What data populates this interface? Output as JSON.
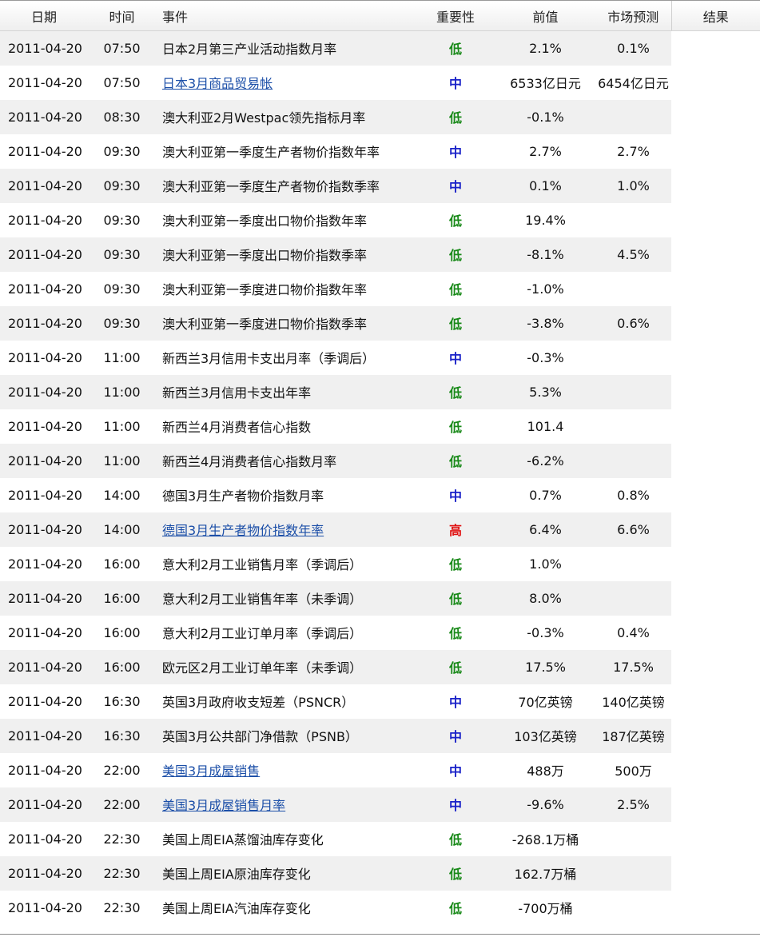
{
  "headers": {
    "date": "日期",
    "time": "时间",
    "event": "事件",
    "importance": "重要性",
    "previous": "前值",
    "forecast": "市场预测",
    "result": "结果"
  },
  "importance_colors": {
    "低": "#1a8a1a",
    "中": "#1a22c8",
    "高": "#e01010"
  },
  "rows": [
    {
      "date": "2011-04-20",
      "time": "07:50",
      "event": "日本2月第三产业活动指数月率",
      "link": false,
      "importance": "低",
      "previous": "2.1%",
      "forecast": "0.1%",
      "result": ""
    },
    {
      "date": "2011-04-20",
      "time": "07:50",
      "event": "日本3月商品贸易帐",
      "link": true,
      "importance": "中",
      "previous": "6533亿日元",
      "forecast": "6454亿日元",
      "result": ""
    },
    {
      "date": "2011-04-20",
      "time": "08:30",
      "event": "澳大利亚2月Westpac领先指标月率",
      "link": false,
      "importance": "低",
      "previous": "-0.1%",
      "forecast": "",
      "result": ""
    },
    {
      "date": "2011-04-20",
      "time": "09:30",
      "event": "澳大利亚第一季度生产者物价指数年率",
      "link": false,
      "importance": "中",
      "previous": "2.7%",
      "forecast": "2.7%",
      "result": ""
    },
    {
      "date": "2011-04-20",
      "time": "09:30",
      "event": "澳大利亚第一季度生产者物价指数季率",
      "link": false,
      "importance": "中",
      "previous": "0.1%",
      "forecast": "1.0%",
      "result": ""
    },
    {
      "date": "2011-04-20",
      "time": "09:30",
      "event": "澳大利亚第一季度出口物价指数年率",
      "link": false,
      "importance": "低",
      "previous": "19.4%",
      "forecast": "",
      "result": ""
    },
    {
      "date": "2011-04-20",
      "time": "09:30",
      "event": "澳大利亚第一季度出口物价指数季率",
      "link": false,
      "importance": "低",
      "previous": "-8.1%",
      "forecast": "4.5%",
      "result": ""
    },
    {
      "date": "2011-04-20",
      "time": "09:30",
      "event": "澳大利亚第一季度进口物价指数年率",
      "link": false,
      "importance": "低",
      "previous": "-1.0%",
      "forecast": "",
      "result": ""
    },
    {
      "date": "2011-04-20",
      "time": "09:30",
      "event": "澳大利亚第一季度进口物价指数季率",
      "link": false,
      "importance": "低",
      "previous": "-3.8%",
      "forecast": "0.6%",
      "result": ""
    },
    {
      "date": "2011-04-20",
      "time": "11:00",
      "event": "新西兰3月信用卡支出月率（季调后）",
      "link": false,
      "importance": "中",
      "previous": "-0.3%",
      "forecast": "",
      "result": ""
    },
    {
      "date": "2011-04-20",
      "time": "11:00",
      "event": "新西兰3月信用卡支出年率",
      "link": false,
      "importance": "低",
      "previous": "5.3%",
      "forecast": "",
      "result": ""
    },
    {
      "date": "2011-04-20",
      "time": "11:00",
      "event": "新西兰4月消费者信心指数",
      "link": false,
      "importance": "低",
      "previous": "101.4",
      "forecast": "",
      "result": ""
    },
    {
      "date": "2011-04-20",
      "time": "11:00",
      "event": "新西兰4月消费者信心指数月率",
      "link": false,
      "importance": "低",
      "previous": "-6.2%",
      "forecast": "",
      "result": ""
    },
    {
      "date": "2011-04-20",
      "time": "14:00",
      "event": "德国3月生产者物价指数月率",
      "link": false,
      "importance": "中",
      "previous": "0.7%",
      "forecast": "0.8%",
      "result": ""
    },
    {
      "date": "2011-04-20",
      "time": "14:00",
      "event": "德国3月生产者物价指数年率",
      "link": true,
      "importance": "高",
      "previous": "6.4%",
      "forecast": "6.6%",
      "result": ""
    },
    {
      "date": "2011-04-20",
      "time": "16:00",
      "event": "意大利2月工业销售月率（季调后）",
      "link": false,
      "importance": "低",
      "previous": "1.0%",
      "forecast": "",
      "result": ""
    },
    {
      "date": "2011-04-20",
      "time": "16:00",
      "event": "意大利2月工业销售年率（未季调）",
      "link": false,
      "importance": "低",
      "previous": "8.0%",
      "forecast": "",
      "result": ""
    },
    {
      "date": "2011-04-20",
      "time": "16:00",
      "event": "意大利2月工业订单月率（季调后）",
      "link": false,
      "importance": "低",
      "previous": "-0.3%",
      "forecast": "0.4%",
      "result": ""
    },
    {
      "date": "2011-04-20",
      "time": "16:00",
      "event": "欧元区2月工业订单年率（未季调）",
      "link": false,
      "importance": "低",
      "previous": "17.5%",
      "forecast": "17.5%",
      "result": ""
    },
    {
      "date": "2011-04-20",
      "time": "16:30",
      "event": "英国3月政府收支短差（PSNCR）",
      "link": false,
      "importance": "中",
      "previous": "70亿英镑",
      "forecast": "140亿英镑",
      "result": ""
    },
    {
      "date": "2011-04-20",
      "time": "16:30",
      "event": "英国3月公共部门净借款（PSNB）",
      "link": false,
      "importance": "中",
      "previous": "103亿英镑",
      "forecast": "187亿英镑",
      "result": ""
    },
    {
      "date": "2011-04-20",
      "time": "22:00",
      "event": "美国3月成屋销售",
      "link": true,
      "importance": "中",
      "previous": "488万",
      "forecast": "500万",
      "result": ""
    },
    {
      "date": "2011-04-20",
      "time": "22:00",
      "event": "美国3月成屋销售月率",
      "link": true,
      "importance": "中",
      "previous": "-9.6%",
      "forecast": "2.5%",
      "result": ""
    },
    {
      "date": "2011-04-20",
      "time": "22:30",
      "event": "美国上周EIA蒸馏油库存变化",
      "link": false,
      "importance": "低",
      "previous": "-268.1万桶",
      "forecast": "",
      "result": ""
    },
    {
      "date": "2011-04-20",
      "time": "22:30",
      "event": "美国上周EIA原油库存变化",
      "link": false,
      "importance": "低",
      "previous": "162.7万桶",
      "forecast": "",
      "result": ""
    },
    {
      "date": "2011-04-20",
      "time": "22:30",
      "event": "美国上周EIA汽油库存变化",
      "link": false,
      "importance": "低",
      "previous": "-700万桶",
      "forecast": "",
      "result": ""
    }
  ]
}
